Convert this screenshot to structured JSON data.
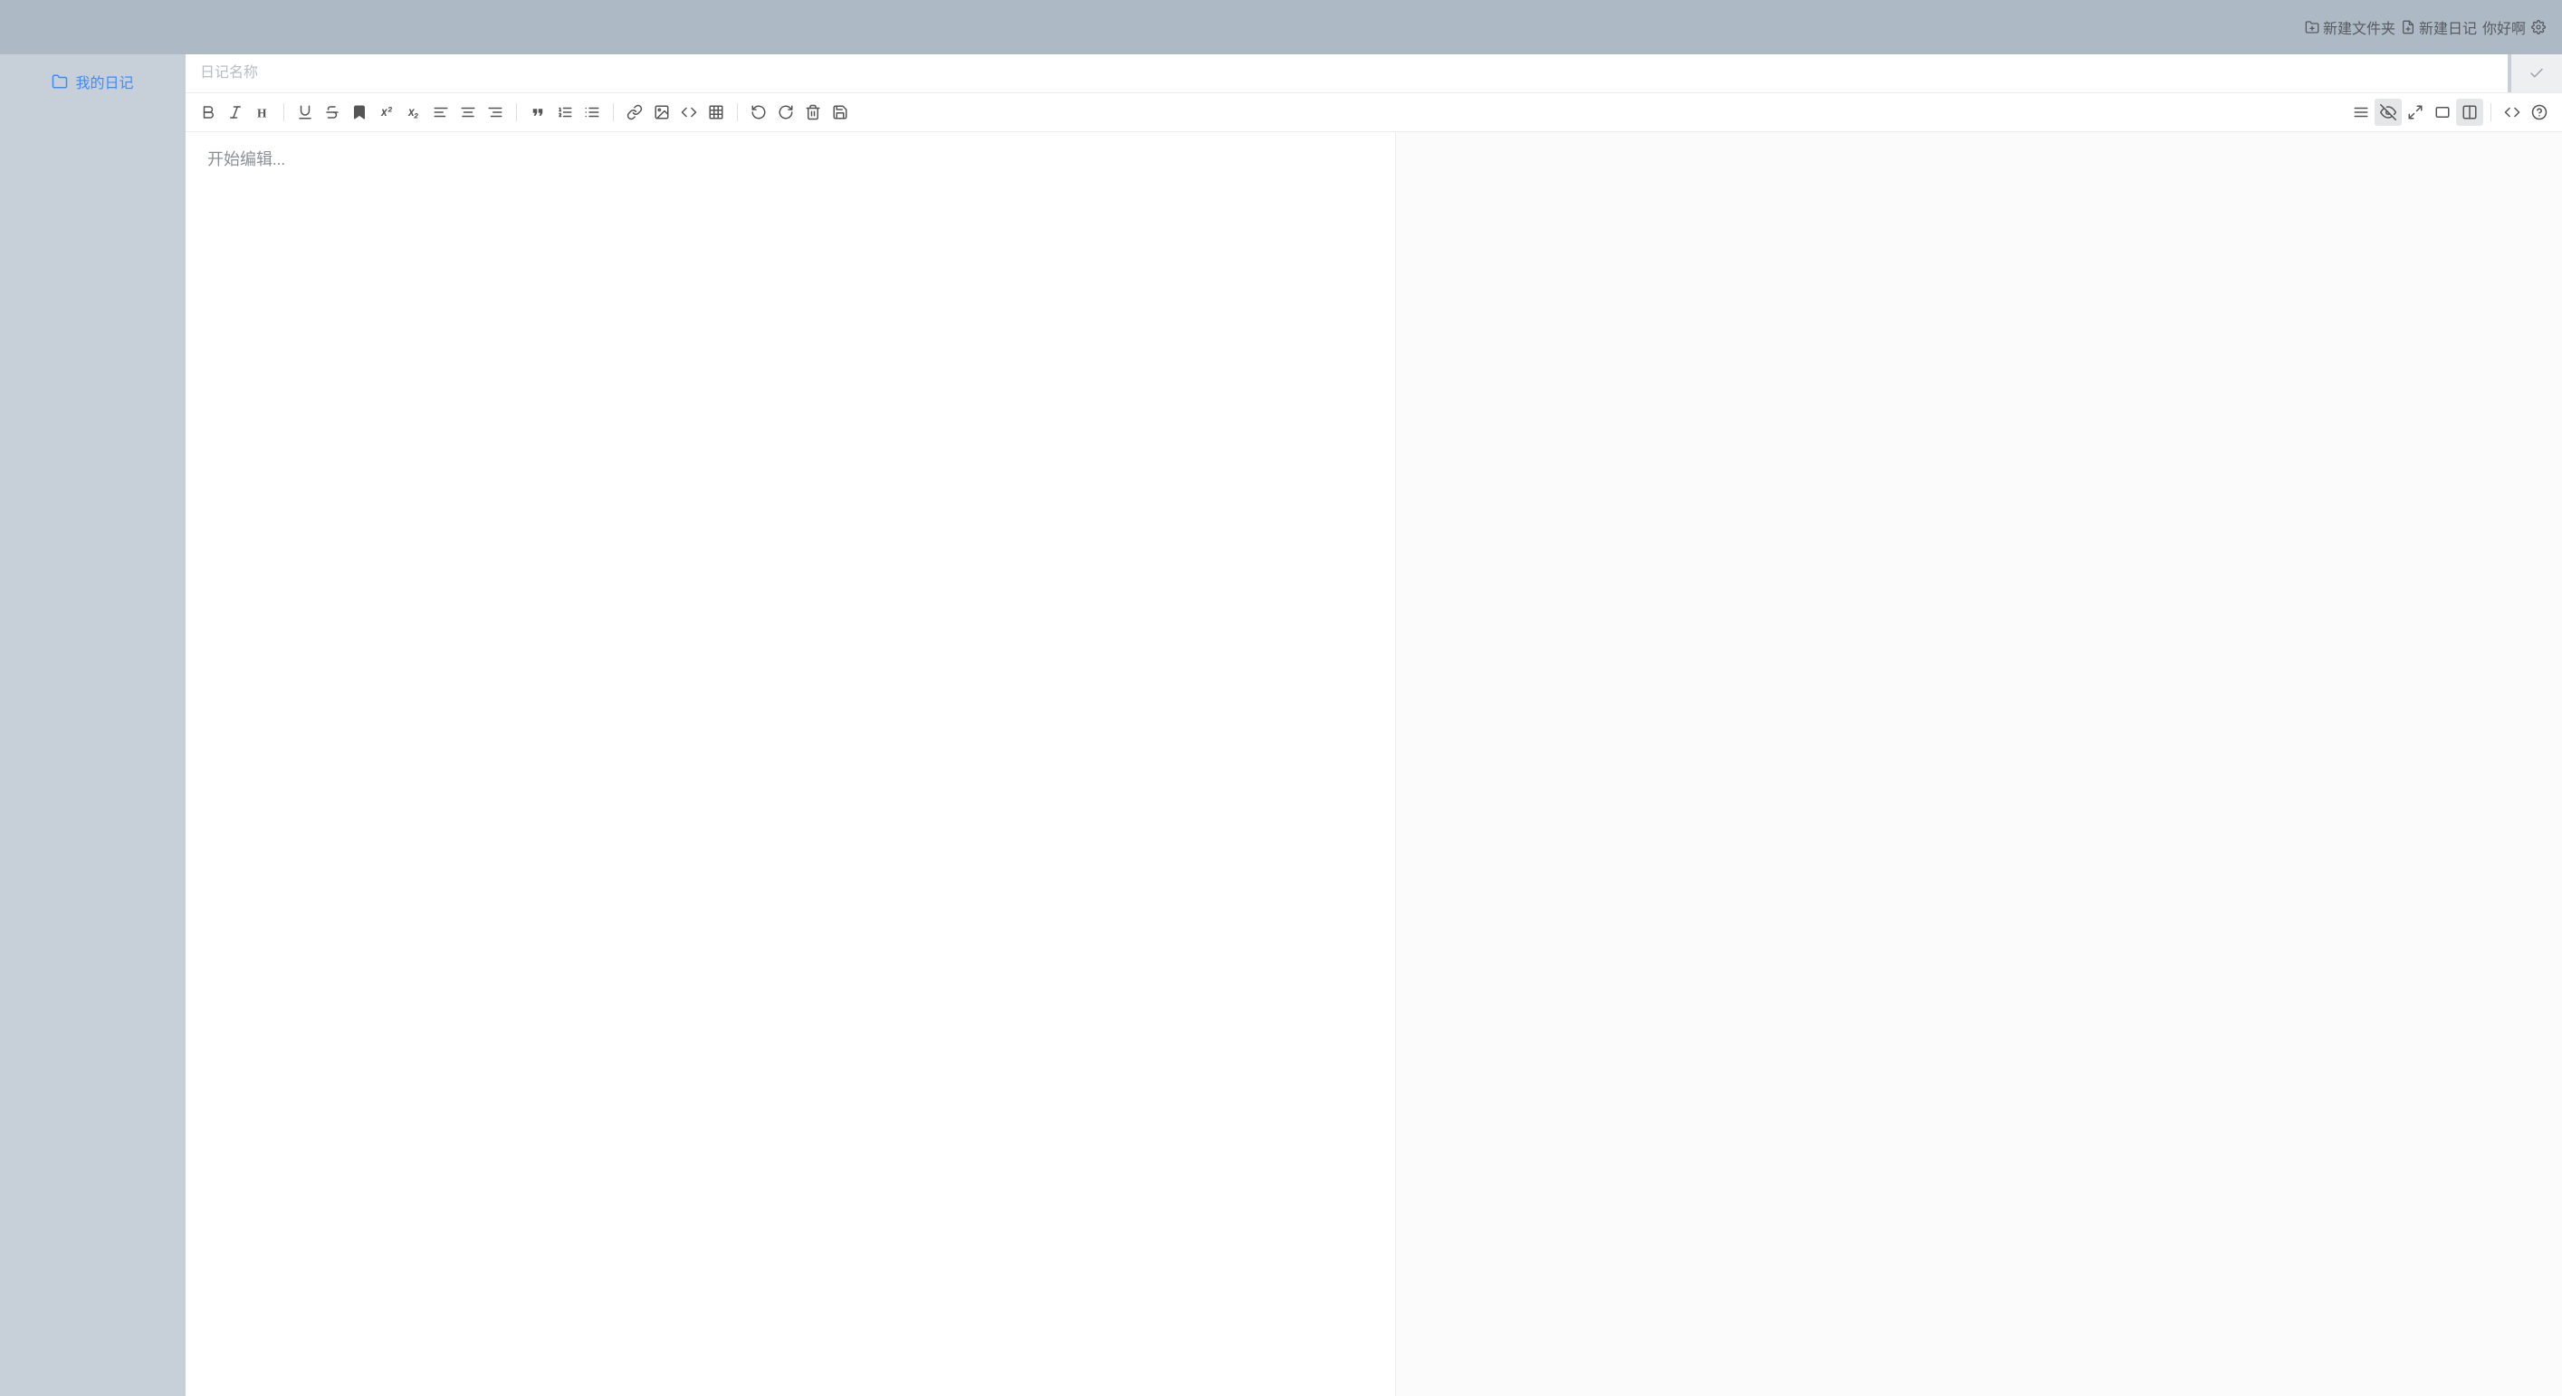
{
  "topbar": {
    "new_folder_label": "新建文件夹",
    "new_diary_label": "新建日记",
    "greeting_label": "你好啊"
  },
  "sidebar": {
    "items": [
      {
        "label": "我的日记"
      }
    ]
  },
  "title": {
    "placeholder": "日记名称",
    "value": ""
  },
  "editor": {
    "placeholder": "开始编辑...",
    "content": ""
  },
  "toolbar": {
    "sup_label": "x²",
    "sub_label": "x₂"
  }
}
